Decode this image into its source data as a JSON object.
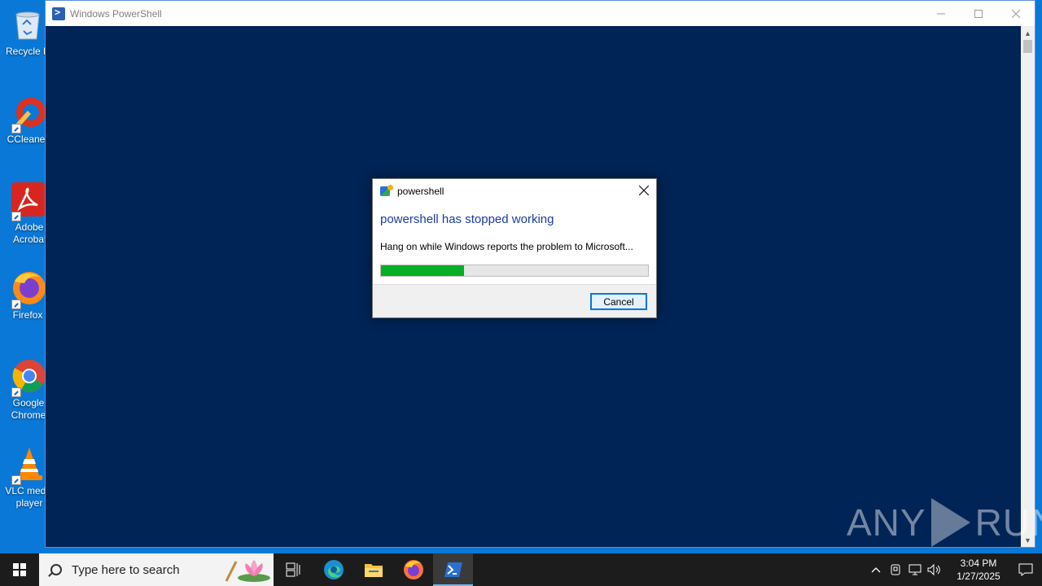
{
  "desktop": {
    "icons": [
      {
        "label": "Recycle Bin",
        "icon": "recycle-bin-icon"
      },
      {
        "label": "CCleaner",
        "icon": "ccleaner-icon"
      },
      {
        "label": "Adobe Acrobat",
        "icon": "adobe-acrobat-icon"
      },
      {
        "label": "Firefox",
        "icon": "firefox-icon"
      },
      {
        "label": "Google Chrome",
        "icon": "chrome-icon"
      },
      {
        "label": "VLC media player",
        "icon": "vlc-icon"
      }
    ]
  },
  "window": {
    "title": "Windows PowerShell",
    "background": "#012456"
  },
  "dialog": {
    "title": "powershell",
    "heading": "powershell has stopped working",
    "message": "Hang on while Windows reports the problem to Microsoft...",
    "progress": 0.31,
    "cancel_label": "Cancel"
  },
  "watermark": {
    "left": "ANY",
    "right": "RUN"
  },
  "taskbar": {
    "search_placeholder": "Type here to search",
    "apps": [
      "task-view-icon",
      "edge-icon",
      "file-explorer-icon",
      "firefox-icon",
      "powershell-icon"
    ],
    "active_app": "powershell-icon",
    "time": "3:04 PM",
    "date": "1/27/2025"
  },
  "colors": {
    "desktop": "#0a78d7",
    "progress_fill": "#06b025",
    "dialog_heading": "#1c3a9e",
    "taskbar": "#1c1c1c"
  }
}
